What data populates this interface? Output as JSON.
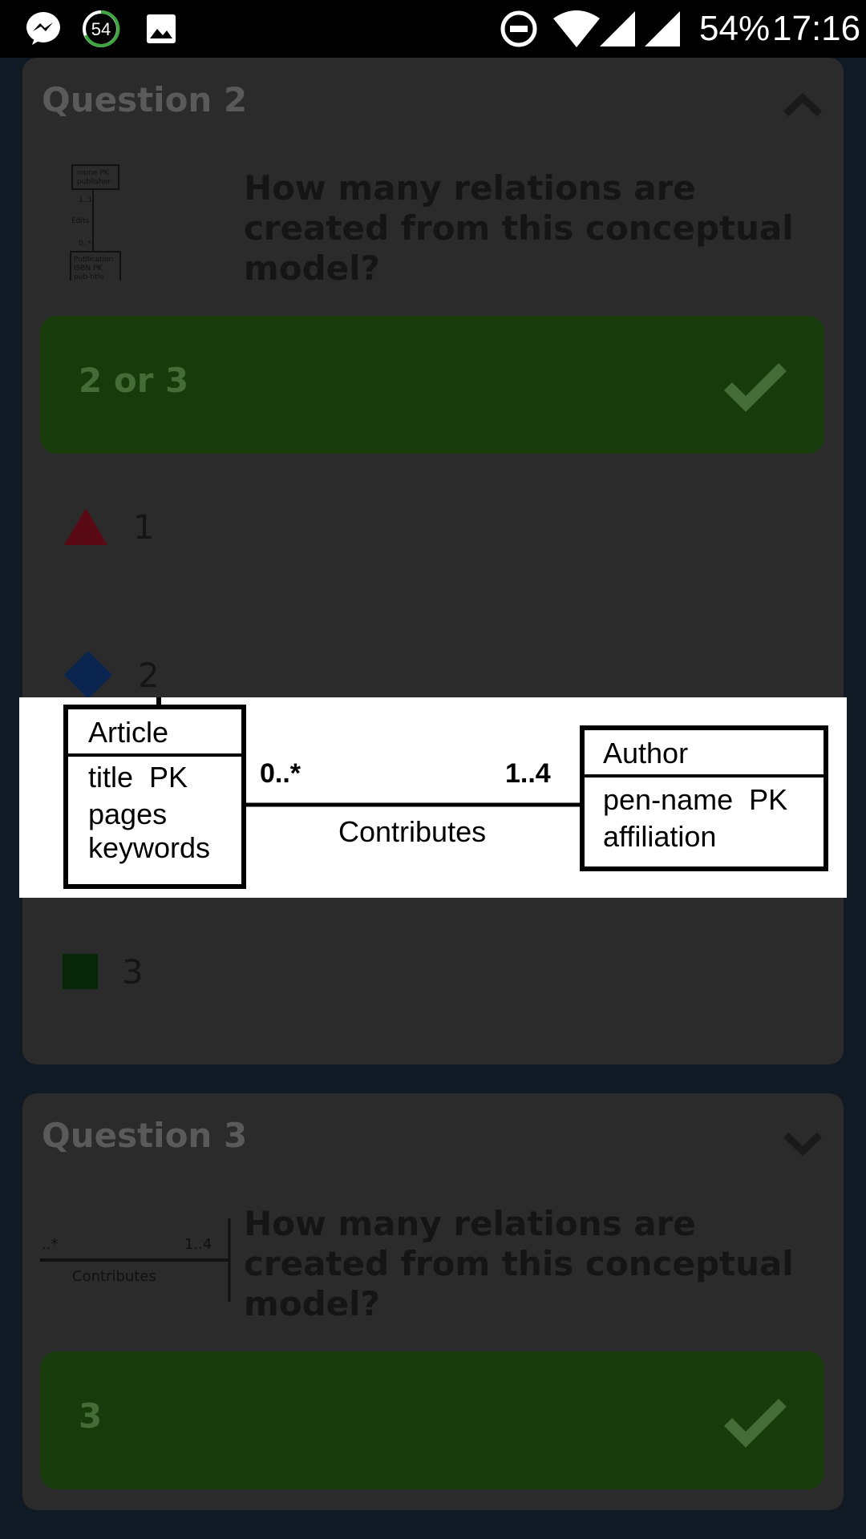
{
  "status_bar": {
    "icons": [
      "messenger-icon",
      "notification-counter-icon",
      "gallery-icon",
      "do-not-disturb-icon",
      "wifi-icon",
      "signal-icon",
      "signal-icon"
    ],
    "notification_count": "54",
    "battery": "54%",
    "time": "17:16"
  },
  "question2": {
    "title": "Question 2",
    "text": "How many relations are created from this conceptual model?",
    "correct_answer": "2 or 3",
    "options": [
      {
        "shape": "triangle",
        "color": "#b0102a",
        "label": "1"
      },
      {
        "shape": "diamond",
        "color": "#0d3b7a",
        "label": "2"
      },
      {
        "shape": "square",
        "color": "#0c3a0c",
        "label": "3"
      }
    ],
    "thumbnail": {
      "box1_line1": "name PK",
      "box1_line2": "publisher",
      "card1": "1..1",
      "rel": "Edits",
      "card2": "0..*",
      "box2_line1": "Publication",
      "box2_line2": "ISBN PK",
      "box2_line3": "pub-title"
    }
  },
  "question3": {
    "title": "Question 3",
    "text": "How many relations are created from this conceptual model?",
    "correct_answer": "3",
    "thumbnail": {
      "left_card": "..*",
      "right_card": "1..4",
      "rel": "Contributes"
    }
  },
  "zoomed_diagram": {
    "entity1": {
      "name": "Article",
      "attrs": [
        "title  PK",
        "pages",
        "keywords"
      ]
    },
    "entity2": {
      "name": "Author",
      "attrs": [
        "pen-name  PK",
        "affiliation"
      ]
    },
    "left_cardinality": "0..*",
    "right_cardinality": "1..4",
    "relationship": "Contributes"
  },
  "colors": {
    "answer_bar": "#173b0b",
    "card_bg": "#2b2b2b",
    "page_bg": "#0f1a24"
  }
}
